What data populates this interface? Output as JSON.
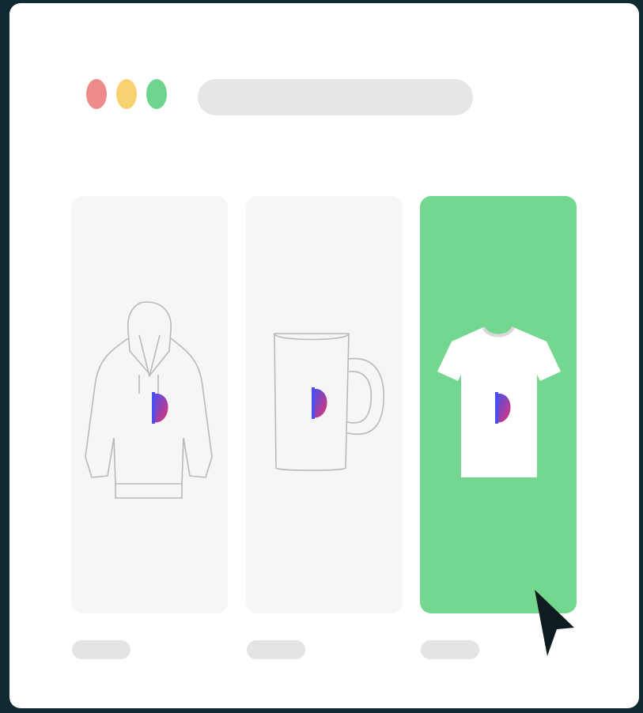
{
  "window": {
    "traffic_lights": [
      "red",
      "yellow",
      "green"
    ],
    "address_bar": ""
  },
  "colors": {
    "page_background": "#0f2a31",
    "window_background": "#ffffff",
    "traffic_red": "#ef8a8a",
    "traffic_yellow": "#f6d271",
    "traffic_green": "#6fd58e",
    "card_background": "#f6f6f6",
    "selected_card": "#74d790",
    "logo_blue": "#4b4ff0",
    "logo_pink": "#e2336b"
  },
  "products": [
    {
      "item": "hoodie",
      "icon": "hoodie-icon",
      "selected": false,
      "caption": ""
    },
    {
      "item": "mug",
      "icon": "mug-icon",
      "selected": false,
      "caption": ""
    },
    {
      "item": "t-shirt",
      "icon": "tshirt-icon",
      "selected": true,
      "caption": ""
    }
  ],
  "cursor": {
    "icon": "mouse-pointer-icon"
  }
}
